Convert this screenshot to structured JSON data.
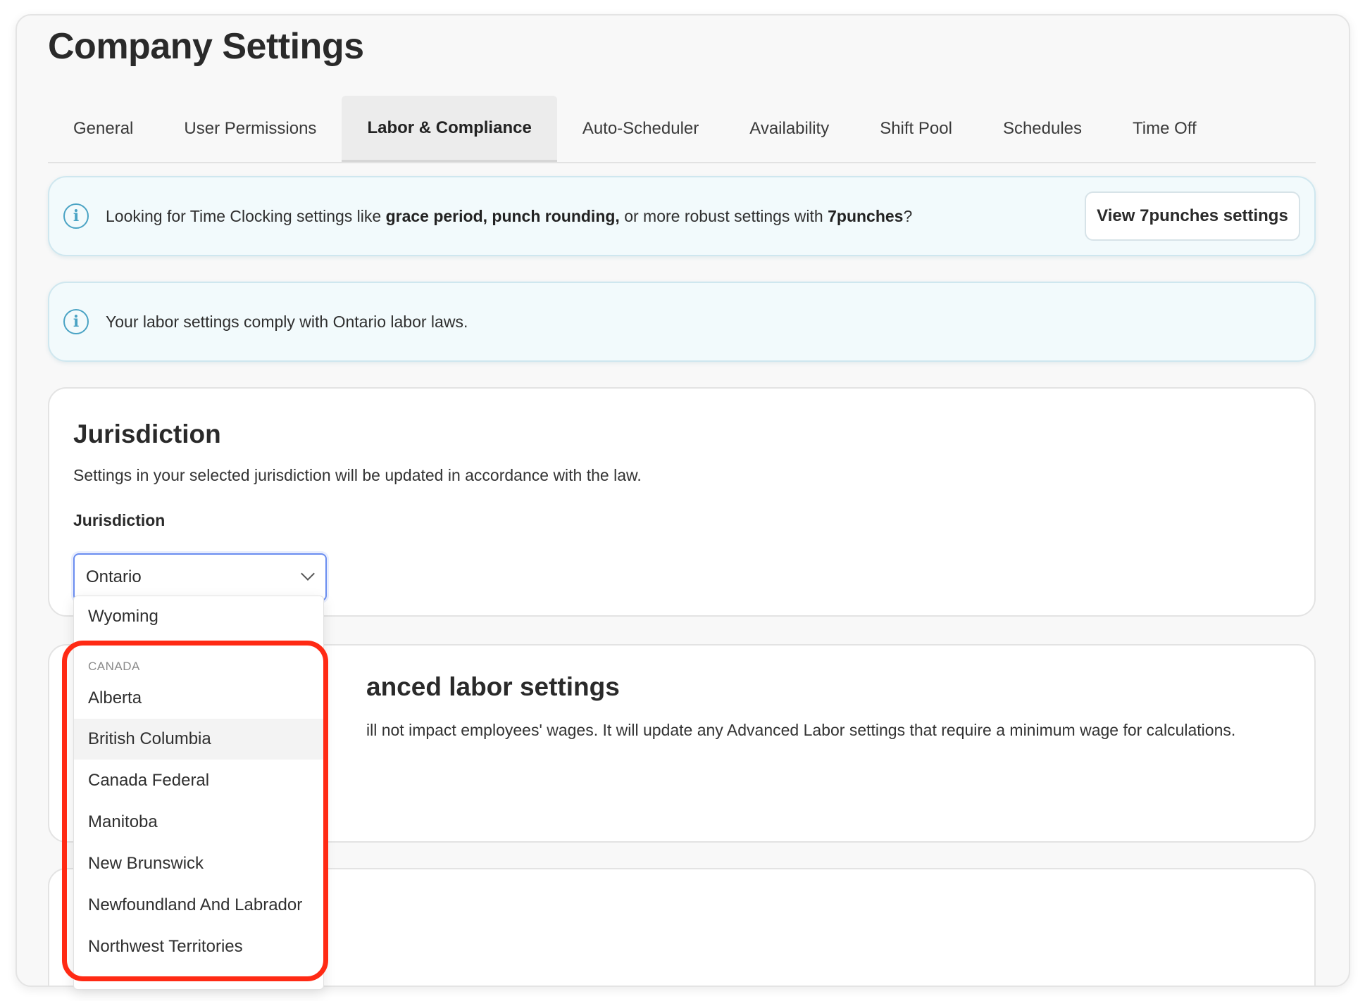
{
  "page": {
    "title": "Company Settings"
  },
  "tabs": [
    {
      "label": "General",
      "active": false
    },
    {
      "label": "User Permissions",
      "active": false
    },
    {
      "label": "Labor & Compliance",
      "active": true
    },
    {
      "label": "Auto-Scheduler",
      "active": false
    },
    {
      "label": "Availability",
      "active": false
    },
    {
      "label": "Shift Pool",
      "active": false
    },
    {
      "label": "Schedules",
      "active": false
    },
    {
      "label": "Time Off",
      "active": false
    }
  ],
  "banner_timeclock": {
    "text_before": "Looking for Time Clocking settings like ",
    "bold_1": "grace period, punch rounding,",
    "text_middle": " or more robust settings with ",
    "bold_2": "7punches",
    "text_after": "?",
    "button_label": "View 7punches settings",
    "icon": "info-icon"
  },
  "banner_compliance": {
    "text": "Your labor settings comply with Ontario labor laws.",
    "icon": "info-icon"
  },
  "jurisdiction_card": {
    "title": "Jurisdiction",
    "description": "Settings in your selected jurisdiction will be updated in accordance with the law.",
    "field_label": "Jurisdiction",
    "selected_value": "Ontario"
  },
  "advanced_card": {
    "title_partial": "anced labor settings",
    "description_partial": "ill not impact employees' wages. It will update any Advanced Labor settings that require a minimum wage for calculations."
  },
  "dropdown": {
    "top_option": "Wyoming",
    "group_label": "CANADA",
    "options": [
      {
        "label": "Alberta",
        "hover": false
      },
      {
        "label": "British Columbia",
        "hover": true
      },
      {
        "label": "Canada Federal",
        "hover": false
      },
      {
        "label": "Manitoba",
        "hover": false
      },
      {
        "label": "New Brunswick",
        "hover": false
      },
      {
        "label": "Newfoundland And Labrador",
        "hover": false
      },
      {
        "label": "Northwest Territories",
        "hover": false
      }
    ]
  },
  "colors": {
    "highlight": "#ff2a14",
    "info_accent": "#4aa3c4",
    "select_focus": "#6a8df0"
  }
}
